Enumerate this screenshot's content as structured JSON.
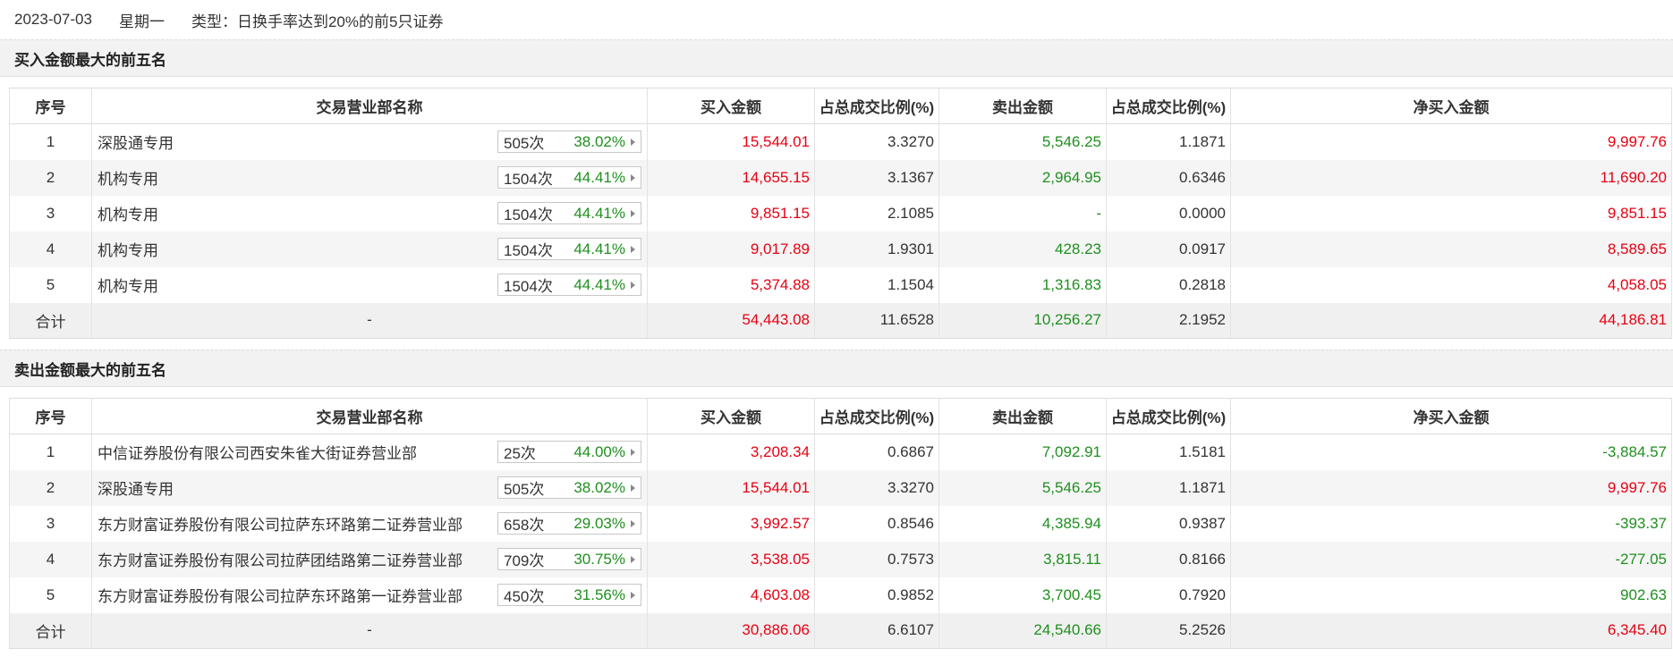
{
  "top": {
    "date": "2023-07-03",
    "weekday": "星期一",
    "type": "类型：日换手率达到20%的前5只证券"
  },
  "headers": [
    "序号",
    "交易营业部名称",
    "买入金额",
    "占总成交比例(%)",
    "卖出金额",
    "占总成交比例(%)",
    "净买入金额"
  ],
  "buy": {
    "title": "买入金额最大的前五名",
    "rows": [
      {
        "no": "1",
        "name": "深股通专用",
        "cnt": "505次",
        "pct": "38.02%",
        "buy": "15,544.01",
        "buyPct": "3.3270",
        "sell": "5,546.25",
        "sellPct": "1.1871",
        "net": "9,997.76",
        "netColor": "red"
      },
      {
        "no": "2",
        "name": "机构专用",
        "cnt": "1504次",
        "pct": "44.41%",
        "buy": "14,655.15",
        "buyPct": "3.1367",
        "sell": "2,964.95",
        "sellPct": "0.6346",
        "net": "11,690.20",
        "netColor": "red"
      },
      {
        "no": "3",
        "name": "机构专用",
        "cnt": "1504次",
        "pct": "44.41%",
        "buy": "9,851.15",
        "buyPct": "2.1085",
        "sell": "-",
        "sellPct": "0.0000",
        "net": "9,851.15",
        "netColor": "red"
      },
      {
        "no": "4",
        "name": "机构专用",
        "cnt": "1504次",
        "pct": "44.41%",
        "buy": "9,017.89",
        "buyPct": "1.9301",
        "sell": "428.23",
        "sellPct": "0.0917",
        "net": "8,589.65",
        "netColor": "red"
      },
      {
        "no": "5",
        "name": "机构专用",
        "cnt": "1504次",
        "pct": "44.41%",
        "buy": "5,374.88",
        "buyPct": "1.1504",
        "sell": "1,316.83",
        "sellPct": "0.2818",
        "net": "4,058.05",
        "netColor": "red"
      }
    ],
    "total": {
      "label": "合计",
      "name": "-",
      "buy": "54,443.08",
      "buyPct": "11.6528",
      "sell": "10,256.27",
      "sellPct": "2.1952",
      "net": "44,186.81",
      "netColor": "red"
    }
  },
  "sell": {
    "title": "卖出金额最大的前五名",
    "rows": [
      {
        "no": "1",
        "name": "中信证券股份有限公司西安朱雀大街证券营业部",
        "cnt": "25次",
        "pct": "44.00%",
        "buy": "3,208.34",
        "buyPct": "0.6867",
        "sell": "7,092.91",
        "sellPct": "1.5181",
        "net": "-3,884.57",
        "netColor": "green"
      },
      {
        "no": "2",
        "name": "深股通专用",
        "cnt": "505次",
        "pct": "38.02%",
        "buy": "15,544.01",
        "buyPct": "3.3270",
        "sell": "5,546.25",
        "sellPct": "1.1871",
        "net": "9,997.76",
        "netColor": "red"
      },
      {
        "no": "3",
        "name": "东方财富证券股份有限公司拉萨东环路第二证券营业部",
        "cnt": "658次",
        "pct": "29.03%",
        "buy": "3,992.57",
        "buyPct": "0.8546",
        "sell": "4,385.94",
        "sellPct": "0.9387",
        "net": "-393.37",
        "netColor": "green"
      },
      {
        "no": "4",
        "name": "东方财富证券股份有限公司拉萨团结路第二证券营业部",
        "cnt": "709次",
        "pct": "30.75%",
        "buy": "3,538.05",
        "buyPct": "0.7573",
        "sell": "3,815.11",
        "sellPct": "0.8166",
        "net": "-277.05",
        "netColor": "green"
      },
      {
        "no": "5",
        "name": "东方财富证券股份有限公司拉萨东环路第一证券营业部",
        "cnt": "450次",
        "pct": "31.56%",
        "buy": "4,603.08",
        "buyPct": "0.9852",
        "sell": "3,700.45",
        "sellPct": "0.7920",
        "net": "902.63",
        "netColor": "green"
      }
    ],
    "total": {
      "label": "合计",
      "name": "-",
      "buy": "30,886.06",
      "buyPct": "6.6107",
      "sell": "24,540.66",
      "sellPct": "5.2526",
      "net": "6,345.40",
      "netColor": "red"
    }
  }
}
